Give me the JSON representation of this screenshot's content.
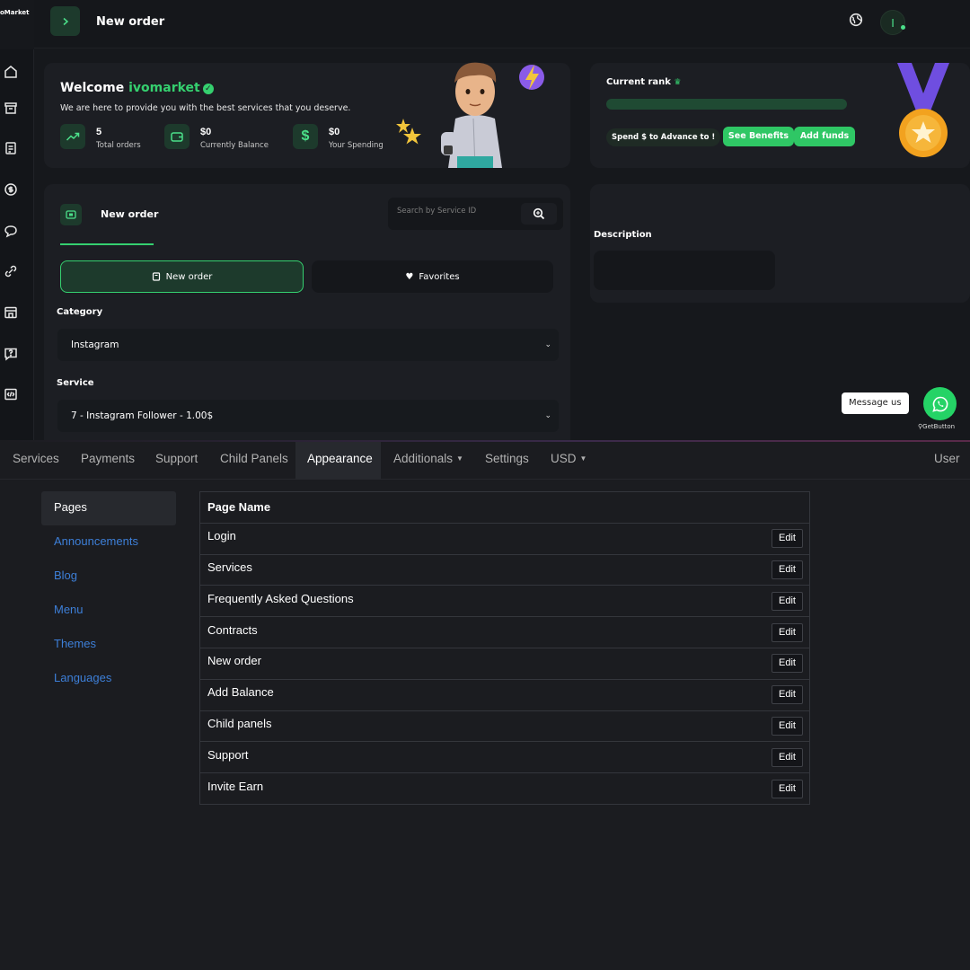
{
  "brand": "oMarket",
  "topbar": {
    "title": "New order"
  },
  "avatar": {
    "initial": "I"
  },
  "welcome": {
    "greeting": "Welcome",
    "username": "ivomarket",
    "subtitle": "We are here to provide you with the best services that you deserve.",
    "stats": [
      {
        "value": "5",
        "label": "Total orders",
        "icon": "trend-up-icon"
      },
      {
        "value": "$0",
        "label": "Currently Balance",
        "icon": "wallet-icon"
      },
      {
        "value": "$0",
        "label": "Your Spending",
        "icon": "dollar-icon"
      }
    ]
  },
  "rank": {
    "title": "Current rank",
    "advance_text": "Spend $ to Advance to !",
    "see_benefits": "See Benefits",
    "add_funds": "Add funds"
  },
  "order_panel": {
    "tab_label": "New order",
    "search_placeholder": "Search by Service ID",
    "new_order_btn": "New order",
    "favorites_btn": "Favorites",
    "category_label": "Category",
    "category_value": "Instagram",
    "service_label": "Service",
    "service_value": "7 - Instagram Follower - 1.00$"
  },
  "description": {
    "label": "Description"
  },
  "whatsapp": {
    "message": "Message us",
    "credit": "GetButton"
  },
  "admin_nav": {
    "items": [
      {
        "label": "Services"
      },
      {
        "label": "Payments"
      },
      {
        "label": "Support"
      },
      {
        "label": "Child Panels"
      },
      {
        "label": "Appearance"
      },
      {
        "label": "Additionals"
      },
      {
        "label": "Settings"
      },
      {
        "label": "USD"
      }
    ],
    "user": "User"
  },
  "left_menu": [
    {
      "label": "Pages"
    },
    {
      "label": "Announcements"
    },
    {
      "label": "Blog"
    },
    {
      "label": "Menu"
    },
    {
      "label": "Themes"
    },
    {
      "label": "Languages"
    }
  ],
  "pages_table": {
    "header": "Page Name",
    "edit_label": "Edit",
    "rows": [
      "Login",
      "Services",
      "Frequently Asked Questions",
      "Contracts",
      "New order",
      "Add Balance",
      "Child panels",
      "Support",
      "Invite Earn"
    ]
  },
  "colors": {
    "accent": "#35d06f",
    "link": "#3d7fd8",
    "whatsapp": "#25d366"
  }
}
